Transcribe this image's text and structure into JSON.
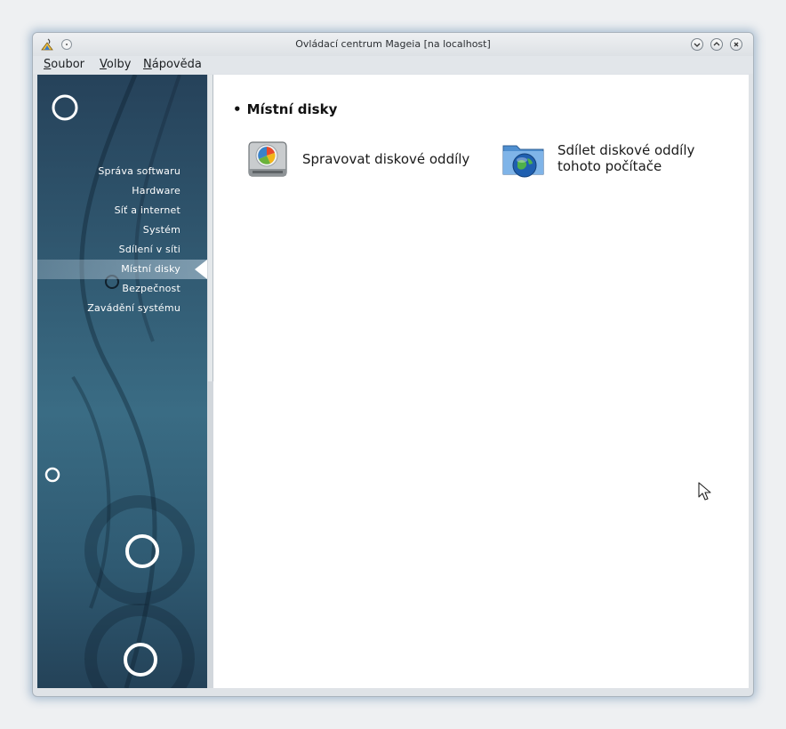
{
  "window": {
    "title": "Ovládací centrum Mageia  [na localhost]"
  },
  "menubar": {
    "items": [
      {
        "accel": "S",
        "rest": "oubor"
      },
      {
        "accel": "V",
        "rest": "olby"
      },
      {
        "accel": "N",
        "rest": "ápověda"
      }
    ]
  },
  "sidebar": {
    "items": [
      {
        "label": "Správa softwaru"
      },
      {
        "label": "Hardware"
      },
      {
        "label": "Síť a internet"
      },
      {
        "label": "Systém"
      },
      {
        "label": "Sdílení v síti"
      },
      {
        "label": "Místní disky"
      },
      {
        "label": "Bezpečnost"
      },
      {
        "label": "Zavádění systému"
      }
    ],
    "active_index": 5
  },
  "content": {
    "section_title": "Místní disky",
    "tools": [
      {
        "label_line1": "Spravovat diskové oddíly",
        "label_line2": "",
        "icon": "hard-disk-icon"
      },
      {
        "label_line1": "Sdílet diskové oddíly",
        "label_line2": "tohoto počítače",
        "icon": "network-folder-icon"
      }
    ]
  },
  "colors": {
    "sidebar_dark": "#26425a",
    "sidebar_mid": "#3a6c84",
    "content_bg": "#ffffff"
  }
}
